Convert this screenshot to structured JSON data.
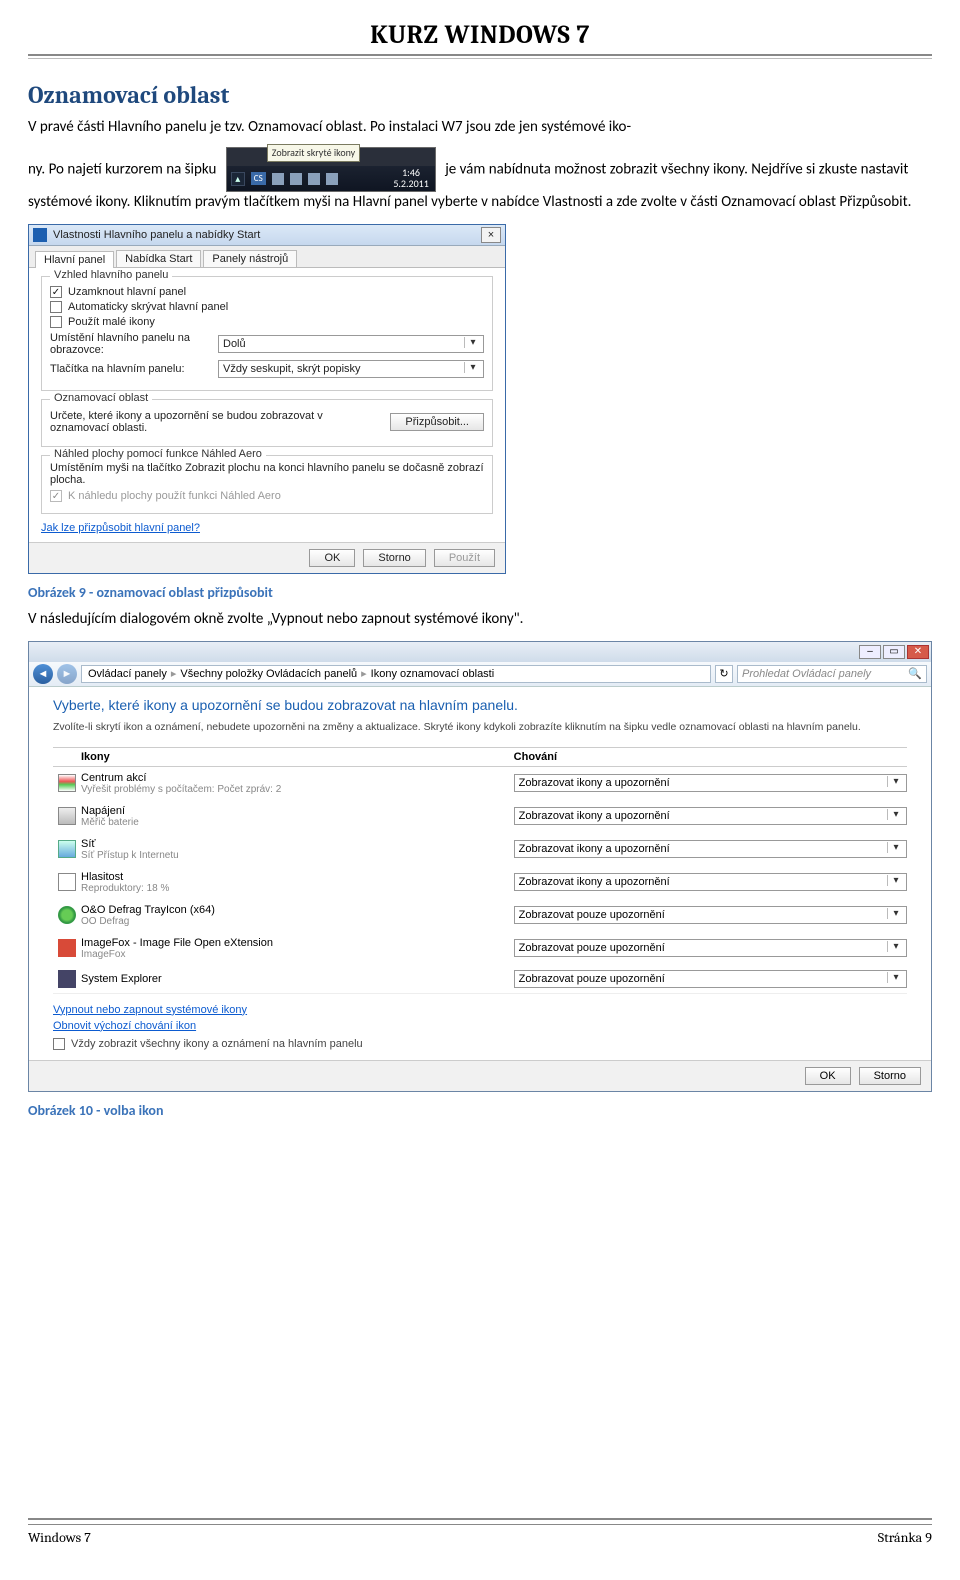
{
  "doc_title": "KURZ WINDOWS 7",
  "section_heading": "Oznamovací oblast",
  "para1a": "V pravé části Hlavního panelu je tzv. Oznamovací oblast. Po instalaci W7 jsou zde jen systémové iko-",
  "para1b_before": "ny. Po najetí kurzorem na šipku ",
  "para1b_after": " je vám nabídnuta možnost zobrazit všechny ikony. Nejdříve si zkuste nastavit systémové ikony. Kliknutím pravým tlačítkem myši na Hlavní panel vyberte v nabídce Vlastnosti a zde zvolte v části Oznamovací oblast Přizpůsobit.",
  "tray": {
    "tooltip": "Zobrazit skryté ikony",
    "lang": "CS",
    "time": "1:46",
    "date": "5.2.2011"
  },
  "dlg": {
    "title": "Vlastnosti Hlavního panelu a nabídky Start",
    "tabs": [
      "Hlavní panel",
      "Nabídka Start",
      "Panely nástrojů"
    ],
    "grp_appearance": "Vzhled hlavního panelu",
    "chk_lock": "Uzamknout hlavní panel",
    "chk_autohide": "Automaticky skrývat hlavní panel",
    "chk_small": "Použít malé ikony",
    "row_pos_label": "Umístění hlavního panelu na obrazovce:",
    "row_pos_value": "Dolů",
    "row_btns_label": "Tlačítka na hlavním panelu:",
    "row_btns_value": "Vždy seskupit, skrýt popisky",
    "grp_notify": "Oznamovací oblast",
    "notify_text": "Určete, které ikony a upozornění se budou zobrazovat v oznamovací oblasti.",
    "notify_btn": "Přizpůsobit...",
    "grp_aero": "Náhled plochy pomocí funkce Náhled Aero",
    "aero_text": "Umístěním myši na tlačítko Zobrazit plochu na konci hlavního panelu se dočasně zobrazí plocha.",
    "chk_aero": "K náhledu plochy použít funkci Náhled Aero",
    "link": "Jak lze přizpůsobit hlavní panel?",
    "btn_ok": "OK",
    "btn_cancel": "Storno",
    "btn_apply": "Použít"
  },
  "caption1": "Obrázek 9 - oznamovací oblast přizpůsobit",
  "para2": "V následujícím dialogovém okně zvolte „Vypnout nebo zapnout systémové ikony\".",
  "win": {
    "crumb1": "Ovládací panely",
    "crumb2": "Všechny položky Ovládacích panelů",
    "crumb3": "Ikony oznamovací oblasti",
    "search_placeholder": "Prohledat Ovládací panely",
    "heading": "Vyberte, které ikony a upozornění se budou zobrazovat na hlavním panelu.",
    "sub": "Zvolíte-li skrytí ikon a oznámení, nebudete upozorněni na změny a aktualizace. Skryté ikony kdykoli zobrazíte kliknutím na šipku vedle oznamovací oblasti na hlavním panelu.",
    "col_icons": "Ikony",
    "col_behavior": "Chování",
    "rows": [
      {
        "name": "Centrum akcí",
        "sub": "Vyřešit problémy s počítačem: Počet zpráv: 2",
        "sel": "Zobrazovat ikony a upozornění"
      },
      {
        "name": "Napájení",
        "sub": "Měřič baterie",
        "sel": "Zobrazovat ikony a upozornění"
      },
      {
        "name": "Síť",
        "sub": "Síť Přístup k Internetu",
        "sel": "Zobrazovat ikony a upozornění"
      },
      {
        "name": "Hlasitost",
        "sub": "Reproduktory: 18 %",
        "sel": "Zobrazovat ikony a upozornění"
      },
      {
        "name": "O&O Defrag TrayIcon (x64)",
        "sub": "OO Defrag",
        "sel": "Zobrazovat pouze upozornění"
      },
      {
        "name": "ImageFox - Image File Open eXtension",
        "sub": "ImageFox",
        "sel": "Zobrazovat pouze upozornění"
      },
      {
        "name": "System Explorer",
        "sub": "",
        "sel": "Zobrazovat pouze upozornění"
      }
    ],
    "link_toggle": "Vypnout nebo zapnout systémové ikony",
    "link_reset": "Obnovit výchozí chování ikon",
    "chk_always": "Vždy zobrazit všechny ikony a oznámení na hlavním panelu",
    "btn_ok": "OK",
    "btn_cancel": "Storno"
  },
  "caption2": "Obrázek 10 - volba ikon",
  "footer_left": "Windows 7",
  "footer_right": "Stránka 9"
}
